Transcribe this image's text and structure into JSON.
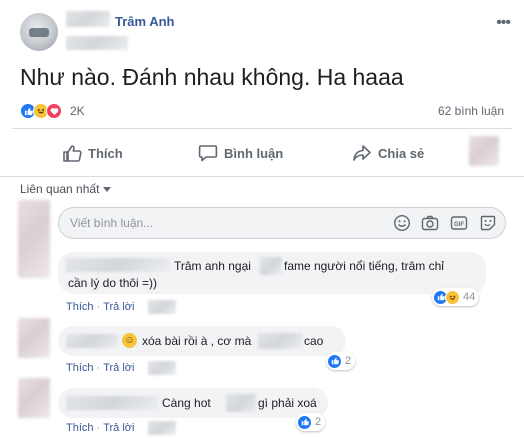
{
  "post": {
    "author": "Trâm Anh",
    "more_label": "•••",
    "text": "Như nào. Đánh nhau không. Ha haaa",
    "reaction_count": "2K",
    "comment_count": "62 bình luận"
  },
  "actions": {
    "like": "Thích",
    "comment": "Bình luận",
    "share": "Chia sẻ"
  },
  "sort_label": "Liên quan nhất",
  "comment_input": {
    "placeholder": "Viết bình luận...",
    "icons": [
      "smiley-icon",
      "camera-icon",
      "gif-icon",
      "sticker-icon"
    ]
  },
  "comments": [
    {
      "text_part1": "Trâm anh ngại",
      "text_part2": "fame người nổi tiếng, trâm chỉ",
      "text_line2": "cần lý do thôi =))",
      "like": "Thích",
      "reply": "Trả lời",
      "reaction_count": "44"
    },
    {
      "emoji": "☺",
      "text_part1": "xóa bài rồi à , cơ mà",
      "text_part2": "cao",
      "like": "Thích",
      "reply": "Trả lời",
      "reaction_count": "2"
    },
    {
      "text_part1": "Càng hot",
      "text_part2": "gì phải xoá",
      "like": "Thích",
      "reply": "Trả lời",
      "reaction_count": "2"
    }
  ],
  "colors": {
    "link": "#385898",
    "like_blue": "#2078f4",
    "haha_yellow": "#f7c33b",
    "love_red": "#f0405e",
    "bubble_gray": "#f2f3f5"
  }
}
